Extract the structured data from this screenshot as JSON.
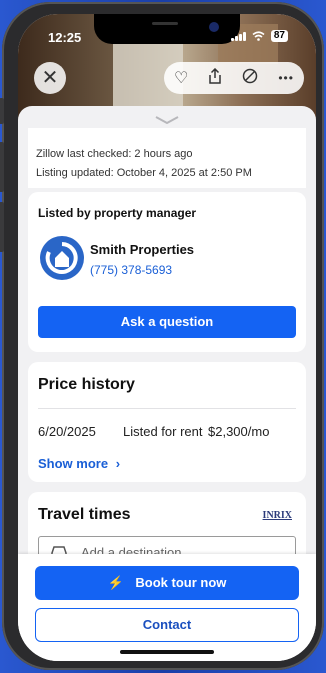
{
  "status_bar": {
    "time": "12:25",
    "battery": "87"
  },
  "top_actions": {
    "close_icon": "close-icon",
    "icons": [
      "heart-icon",
      "share-icon",
      "hide-icon",
      "more-icon"
    ]
  },
  "listing_meta": {
    "zillow_checked": "Zillow last checked: 2 hours ago",
    "listing_updated": "Listing updated: October 4, 2025 at 2:50 PM"
  },
  "property_manager": {
    "section_title": "Listed by property manager",
    "name": "Smith Properties",
    "phone": "(775) 378-5693",
    "ask_button": "Ask a question"
  },
  "price_history": {
    "title": "Price history",
    "rows": [
      {
        "date": "6/20/2025",
        "event": "Listed for rent",
        "price": "$2,300/mo"
      }
    ],
    "show_more": "Show more"
  },
  "travel_times": {
    "title": "Travel times",
    "brand": "INRIX",
    "destination_placeholder": "Add a destination"
  },
  "bottom_actions": {
    "book_tour": "Book tour now",
    "contact": "Contact"
  },
  "colors": {
    "accent": "#1463f3",
    "link": "#1a5fd6",
    "background": "#1f4fc2"
  }
}
